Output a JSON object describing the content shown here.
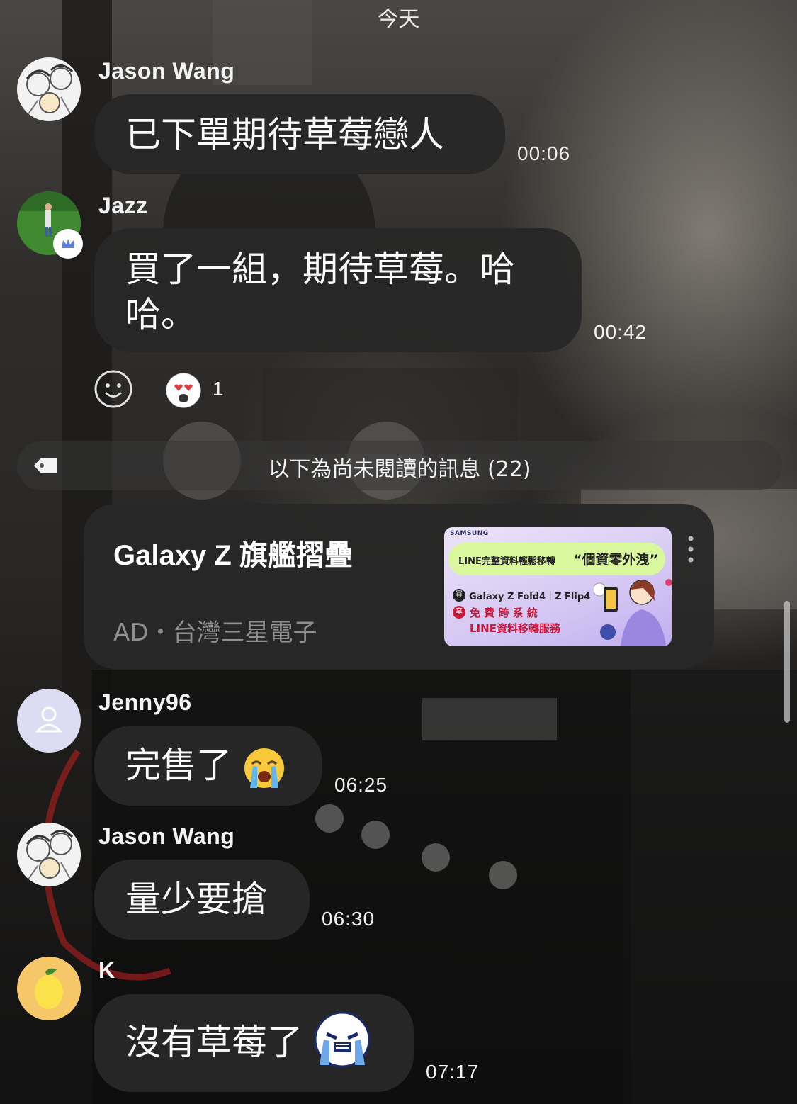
{
  "date_separator": "今天",
  "messages": [
    {
      "sender": "Jason Wang",
      "text": "已下單期待草莓戀人",
      "time": "00:06",
      "avatar": "manga-avatar"
    },
    {
      "sender": "Jazz",
      "line1": "買了一組，期待草莓。哈",
      "line2": "哈。",
      "time": "00:42",
      "avatar": "golf-avatar",
      "reaction_count": "1"
    },
    {
      "sender": "Jenny96",
      "text": "完售了",
      "time": "06:25",
      "avatar": "default-person-avatar",
      "emoji": "loudly-crying-face"
    },
    {
      "sender": "Jason Wang",
      "text": "量少要搶",
      "time": "06:30",
      "avatar": "manga-avatar"
    },
    {
      "sender": "K",
      "text": "沒有草莓了",
      "time": "07:17",
      "avatar": "lemon-avatar",
      "emoji": "crying-sticker-face"
    }
  ],
  "unread_divider": {
    "label": "以下為尚未閱讀的訊息 (22)",
    "icon": "tag-icon"
  },
  "ad": {
    "title": "Galaxy Z 旗艦摺疊",
    "subtitle": "AD・台灣三星電子",
    "image": {
      "brand": "SAMSUNG",
      "headline_small": "LINE完整資料輕鬆移轉",
      "headline_quote": "“個資零外洩”",
      "badge1": "買",
      "models": "Galaxy Z Fold4｜Z Flip4",
      "badge2": "享",
      "offer_line1": "免 費 跨 系 統",
      "offer_line2": "LINE資料移轉服務"
    }
  },
  "colors": {
    "bubble": "#282828",
    "text": "#fafafa",
    "ad_panel_start": "#e7dcf6",
    "ad_panel_end": "#c9b7f0",
    "ad_banner": "#d9f79c"
  }
}
